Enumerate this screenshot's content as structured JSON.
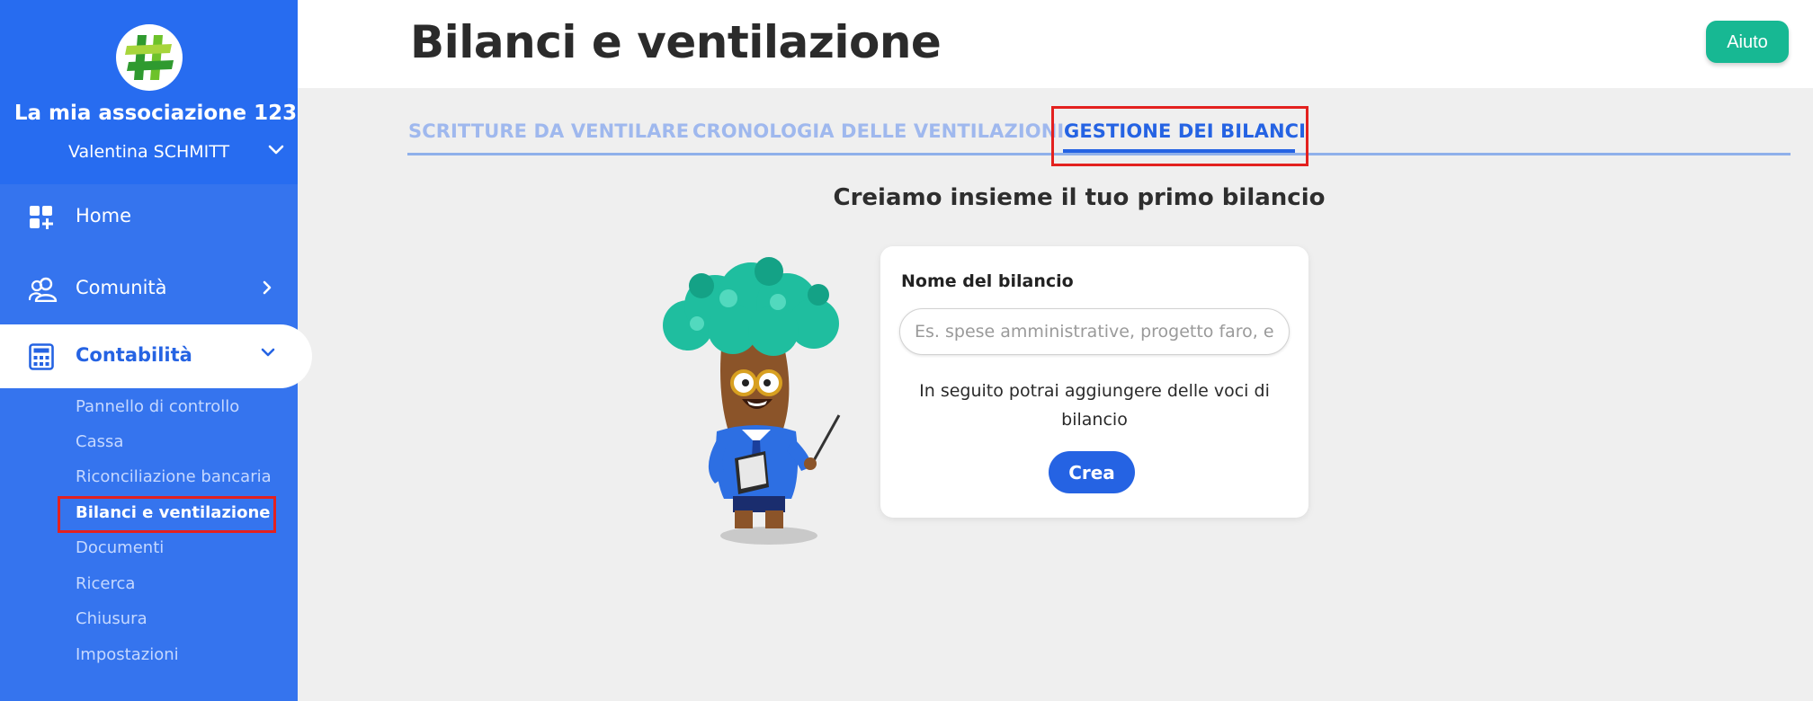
{
  "sidebar": {
    "association_name": "La mia associazione 123",
    "user_name": "Valentina SCHMITT",
    "nav": {
      "home": "Home",
      "community": "Comunità",
      "accounting": "Contabilità"
    },
    "sub_items": [
      "Pannello di controllo",
      "Cassa",
      "Riconciliazione bancaria",
      "Bilanci e ventilazione",
      "Documenti",
      "Ricerca",
      "Chiusura",
      "Impostazioni"
    ],
    "active_sub_index": 3
  },
  "header": {
    "title": "Bilanci e ventilazione",
    "help_label": "Aiuto"
  },
  "tabs": [
    "SCRITTURE DA VENTILARE",
    "CRONOLOGIA DELLE VENTILAZIONI",
    "GESTIONE DEI BILANCI"
  ],
  "active_tab_index": 2,
  "main": {
    "heading": "Creiamo insieme il tuo primo bilancio",
    "card": {
      "field_label": "Nome del bilancio",
      "field_placeholder": "Es. spese amministrative, progetto faro, ecc.",
      "field_value": "",
      "note": "In seguito potrai aggiungere delle voci di bilancio",
      "create_label": "Crea"
    }
  },
  "colors": {
    "sidebar_bg": "#3574ee",
    "sidebar_header_bg": "#276cf0",
    "primary": "#2563e3",
    "help_button": "#17b893",
    "highlight_box": "#e3211f"
  },
  "icons": {
    "logo": "hashtag-logo",
    "home": "dashboard-icon",
    "community": "users-icon",
    "accounting": "calculator-icon"
  }
}
